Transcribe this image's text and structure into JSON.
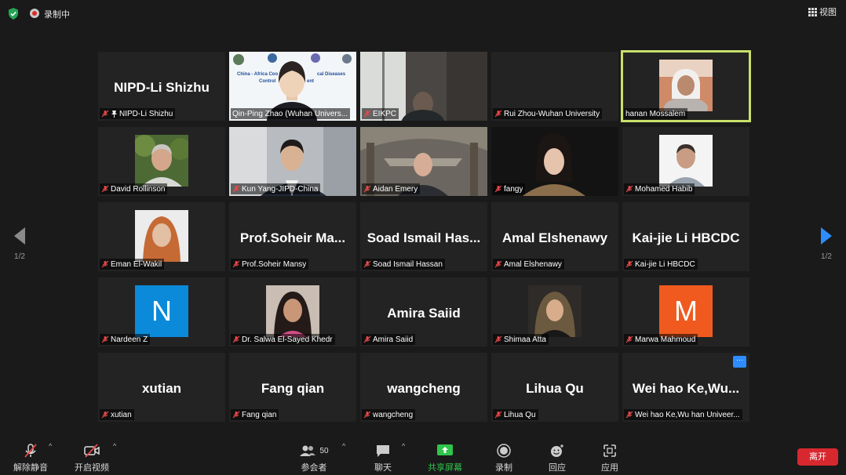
{
  "topbar": {
    "recording_label": "录制中",
    "view_label": "视图"
  },
  "nav": {
    "left_page": "1/2",
    "right_page": "1/2"
  },
  "tiles": [
    {
      "kind": "name",
      "big": "NIPD-Li Shizhu",
      "label": "NIPD-Li Shizhu",
      "pinned": true
    },
    {
      "kind": "video",
      "label": "Qin-Ping Zhao (Wuhan Univers...",
      "slide_line1": "China - Africa Coo",
      "slide_line2": "cal Diseases",
      "slide_line3": "Control",
      "slide_line4": "ent"
    },
    {
      "kind": "video",
      "label": "EIKPC"
    },
    {
      "kind": "name",
      "big": "",
      "label": "Rui Zhou-Wuhan University"
    },
    {
      "kind": "photo",
      "label": "hanan Mossalem",
      "active": true
    },
    {
      "kind": "photo",
      "label": "David Rollinson"
    },
    {
      "kind": "video",
      "label": "Kun Yang-JIPD-China"
    },
    {
      "kind": "video",
      "label": "Aidan Emery"
    },
    {
      "kind": "video",
      "label": "fangy"
    },
    {
      "kind": "photo",
      "label": "Mohamed Habib"
    },
    {
      "kind": "photo",
      "label": "Eman El-Wakil"
    },
    {
      "kind": "name",
      "big": "Prof.Soheir Ma...",
      "label": "Prof.Soheir Mansy"
    },
    {
      "kind": "name",
      "big": "Soad Ismail Has...",
      "label": "Soad Ismail Hassan"
    },
    {
      "kind": "name",
      "big": "Amal Elshenawy",
      "label": "Amal Elshenawy"
    },
    {
      "kind": "name",
      "big": "Kai-jie Li HBCDC",
      "label": "Kai-jie Li HBCDC"
    },
    {
      "kind": "avatar",
      "letter": "N",
      "label": "Nardeen Z"
    },
    {
      "kind": "photo",
      "label": "Dr. Salwa El-Sayed Khedr"
    },
    {
      "kind": "name",
      "big": "Amira Saiid",
      "label": "Amira Saiid"
    },
    {
      "kind": "photo",
      "label": "Shimaa Atta"
    },
    {
      "kind": "avatar",
      "letter": "M",
      "label": "Marwa Mahmoud"
    },
    {
      "kind": "name",
      "big": "xutian",
      "label": "xutian"
    },
    {
      "kind": "name",
      "big": "Fang qian",
      "label": "Fang qian"
    },
    {
      "kind": "name",
      "big": "wangcheng",
      "label": "wangcheng"
    },
    {
      "kind": "name",
      "big": "Lihua Qu",
      "label": "Lihua Qu"
    },
    {
      "kind": "name",
      "big": "Wei hao Ke,Wu...",
      "label": "Wei hao Ke,Wu han Univeer...",
      "more_button": "···"
    }
  ],
  "toolbar": {
    "unmute": "解除静音",
    "start_video": "开启视频",
    "participants": "参会者",
    "participants_count": "50",
    "chat": "聊天",
    "share": "共享屏幕",
    "record": "录制",
    "reactions": "回应",
    "apps": "应用",
    "leave": "离开"
  },
  "colors": {
    "background": "#1a1a1a",
    "tile": "#232323",
    "active_border": "#c8e06a",
    "share_green": "#2fc44b",
    "leave_red": "#d7282f",
    "nav_blue": "#2d8cff"
  }
}
